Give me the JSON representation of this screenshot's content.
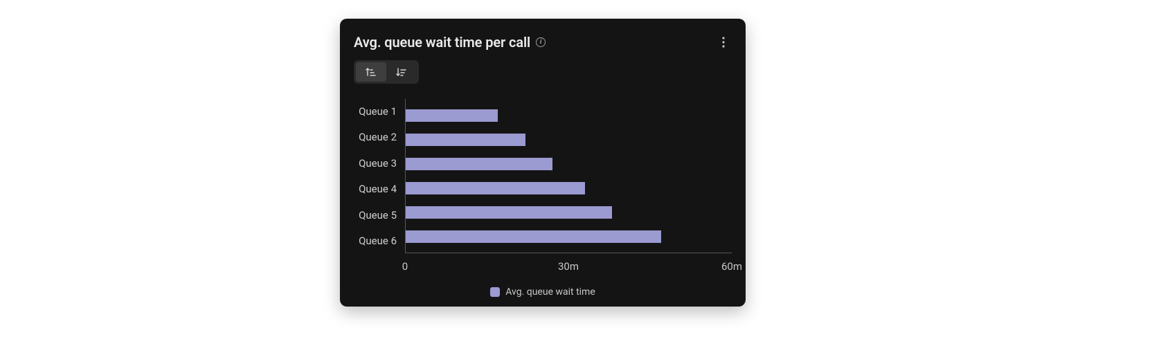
{
  "card": {
    "title": "Avg. queue wait time per call",
    "legend_label": "Avg. queue wait time"
  },
  "x_axis": {
    "ticks": [
      "0",
      "30m",
      "60m"
    ]
  },
  "accent_color": "#9b9ad1",
  "chart_data": {
    "type": "bar",
    "orientation": "horizontal",
    "title": "Avg. queue wait time per call",
    "xlabel": "",
    "ylabel": "",
    "xlim": [
      0,
      60
    ],
    "x_unit": "minutes",
    "categories": [
      "Queue 1",
      "Queue 2",
      "Queue 3",
      "Queue 4",
      "Queue 5",
      "Queue 6"
    ],
    "series": [
      {
        "name": "Avg. queue wait time",
        "values": [
          17,
          22,
          27,
          33,
          38,
          47
        ]
      }
    ],
    "x_ticks": [
      0,
      30,
      60
    ],
    "x_tick_labels": [
      "0",
      "30m",
      "60m"
    ]
  }
}
